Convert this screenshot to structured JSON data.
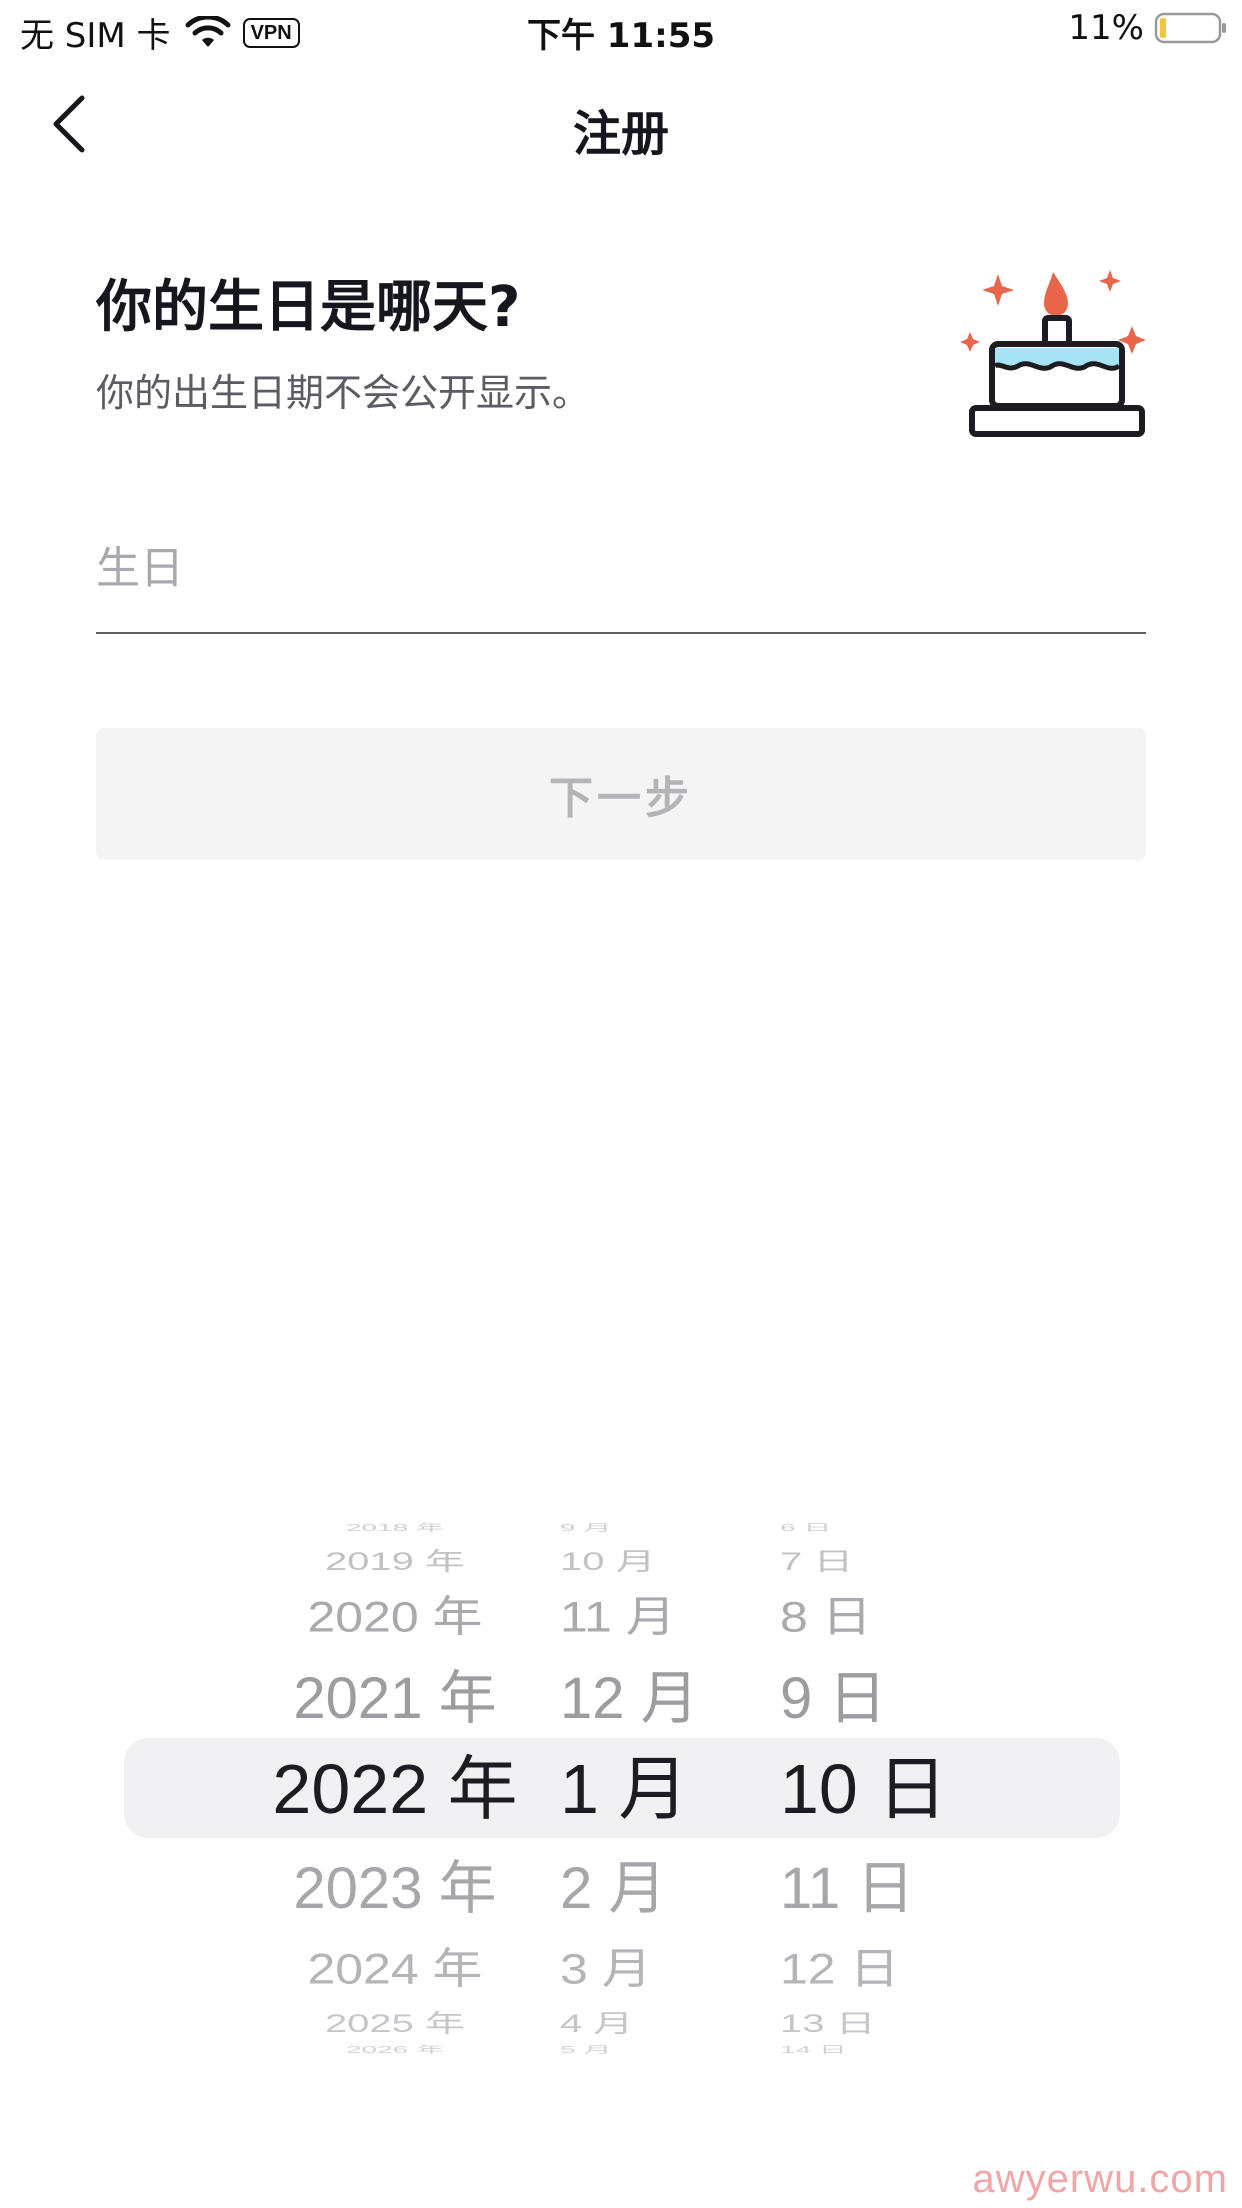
{
  "status_bar": {
    "carrier": "无 SIM 卡",
    "vpn": "VPN",
    "time": "下午 11:55",
    "battery": "11%"
  },
  "nav": {
    "title": "注册"
  },
  "heading": "你的生日是哪天?",
  "subheading": "你的出生日期不会公开显示。",
  "birthday_field": {
    "placeholder": "生日"
  },
  "next_button": "下一步",
  "picker": {
    "years": [
      "2018 年",
      "2019 年",
      "2020 年",
      "2021 年",
      "2022 年",
      "2023 年",
      "2024 年",
      "2025 年",
      "2026 年"
    ],
    "months": [
      "9 月",
      "10 月",
      "11 月",
      "12 月",
      "1 月",
      "2 月",
      "3 月",
      "4 月",
      "5 月"
    ],
    "days": [
      "6 日",
      "7 日",
      "8 日",
      "9 日",
      "10 日",
      "11 日",
      "12 日",
      "13 日",
      "14 日"
    ],
    "selected": {
      "year": "2022 年",
      "month": "1 月",
      "day": "10 日"
    }
  },
  "watermark": "awyerwu.com",
  "colors": {
    "accent_flame": "#e8664b",
    "cake_frosting": "#a6e3f5",
    "disabled_button_bg": "#f4f4f4"
  }
}
